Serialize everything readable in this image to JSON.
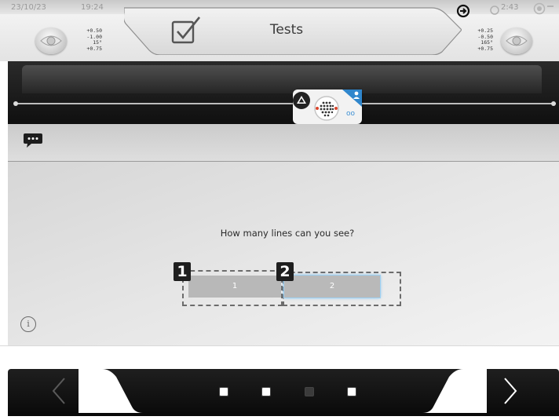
{
  "status": {
    "date": "23/10/23",
    "time": "19:24",
    "right_time": "2:43"
  },
  "header": {
    "title": "Tests"
  },
  "prescription": {
    "left": [
      "+0.50",
      "-1.00",
      "15°",
      "+0.75"
    ],
    "right": [
      "+0.25",
      "-0.50",
      "165°",
      "+0.75"
    ]
  },
  "main": {
    "question": "How many lines can you see?",
    "options": [
      {
        "number": "1",
        "label": "1"
      },
      {
        "number": "2",
        "label": "2"
      }
    ],
    "info_symbol": "i"
  },
  "test_card": {
    "indicator": "oo"
  },
  "pagination": {
    "total": 4,
    "active_index": 2
  },
  "colors": {
    "accent": "#3c8fd3",
    "selected_glow": "#6db8ee",
    "button_bg": "#b8b8b8",
    "dark_band": "#1b1b1b"
  }
}
